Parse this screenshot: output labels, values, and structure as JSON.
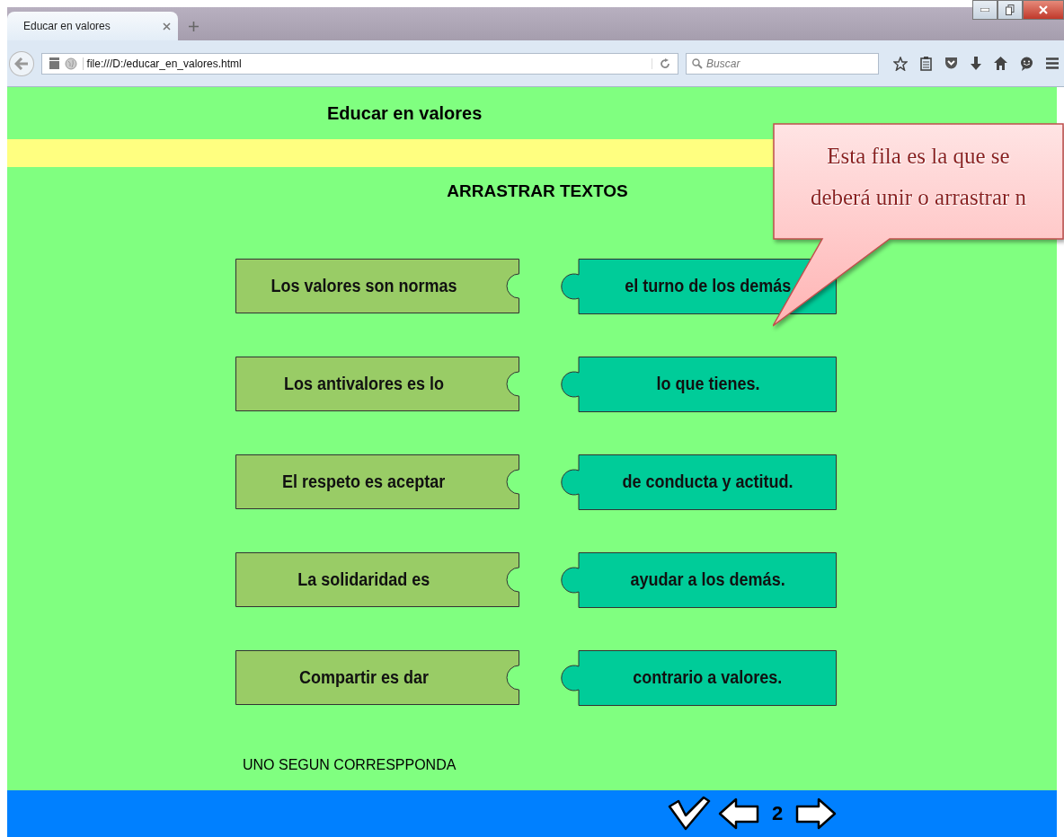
{
  "browser": {
    "tab_title": "Educar en valores",
    "url": "file:///D:/educar_en_valores.html",
    "search": {
      "placeholder": "Buscar"
    }
  },
  "page": {
    "title": "Educar en valores",
    "heading": "ARRASTRAR TEXTOS",
    "left_pieces": [
      "Los valores son normas",
      "Los antivalores es lo",
      "El respeto es aceptar",
      "La solidaridad es",
      "Compartir es dar"
    ],
    "right_pieces": [
      "el turno de los demás",
      "lo que tienes.",
      "de conducta y actitud.",
      "ayudar a los demás.",
      "contrario a valores."
    ],
    "instruction": "UNO SEGUN CORRESPPONDA",
    "callout": "Esta fila es la que se deberá unir o arrastrar n",
    "footer": {
      "page_number": "2"
    }
  }
}
